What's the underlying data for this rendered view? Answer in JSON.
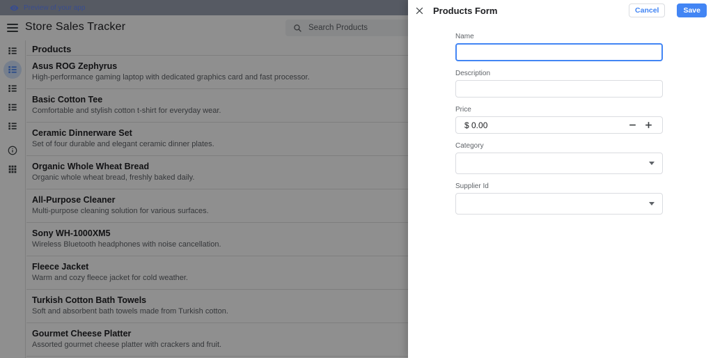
{
  "preview_bar": {
    "label": "Preview of your app"
  },
  "app_bar": {
    "title": "Store Sales Tracker",
    "search_placeholder": "Search Products"
  },
  "sidebar": {
    "items": [
      {
        "icon": "list-icon",
        "selected": false
      },
      {
        "icon": "list-icon",
        "selected": true
      },
      {
        "icon": "list-icon",
        "selected": false
      },
      {
        "icon": "list-icon",
        "selected": false
      },
      {
        "icon": "list-icon",
        "selected": false
      },
      {
        "icon": "info-icon",
        "selected": false
      },
      {
        "icon": "grid-icon",
        "selected": false
      }
    ]
  },
  "list": {
    "header": "Products",
    "products": [
      {
        "name": "Asus ROG Zephyrus",
        "description": "High-performance gaming laptop with dedicated graphics card and fast processor."
      },
      {
        "name": "Basic Cotton Tee",
        "description": "Comfortable and stylish cotton t-shirt for everyday wear."
      },
      {
        "name": "Ceramic Dinnerware Set",
        "description": "Set of four durable and elegant ceramic dinner plates."
      },
      {
        "name": "Organic Whole Wheat Bread",
        "description": "Organic whole wheat bread, freshly baked daily."
      },
      {
        "name": "All-Purpose Cleaner",
        "description": "Multi-purpose cleaning solution for various surfaces."
      },
      {
        "name": "Sony WH-1000XM5",
        "description": "Wireless Bluetooth headphones with noise cancellation."
      },
      {
        "name": "Fleece Jacket",
        "description": "Warm and cozy fleece jacket for cold weather."
      },
      {
        "name": "Turkish Cotton Bath Towels",
        "description": "Soft and absorbent bath towels made from Turkish cotton."
      },
      {
        "name": "Gourmet Cheese Platter",
        "description": "Assorted gourmet cheese platter with crackers and fruit."
      }
    ]
  },
  "drawer": {
    "title": "Products Form",
    "buttons": {
      "cancel": "Cancel",
      "save": "Save"
    },
    "fields": {
      "name": {
        "label": "Name",
        "value": ""
      },
      "description": {
        "label": "Description",
        "value": ""
      },
      "price": {
        "label": "Price",
        "value": "$ 0.00"
      },
      "category": {
        "label": "Category",
        "value": ""
      },
      "supplier_id": {
        "label": "Supplier Id",
        "value": ""
      }
    }
  },
  "colors": {
    "accent": "#4285f4",
    "save_button_bg": "#4285f4",
    "save_button_text": "#ffffff",
    "cancel_button_text": "#4285f4",
    "selected_nav": "#4d86f0",
    "selected_nav_bg": "#d2e3fc",
    "scrim": "rgba(0,0,0,0.44)"
  }
}
